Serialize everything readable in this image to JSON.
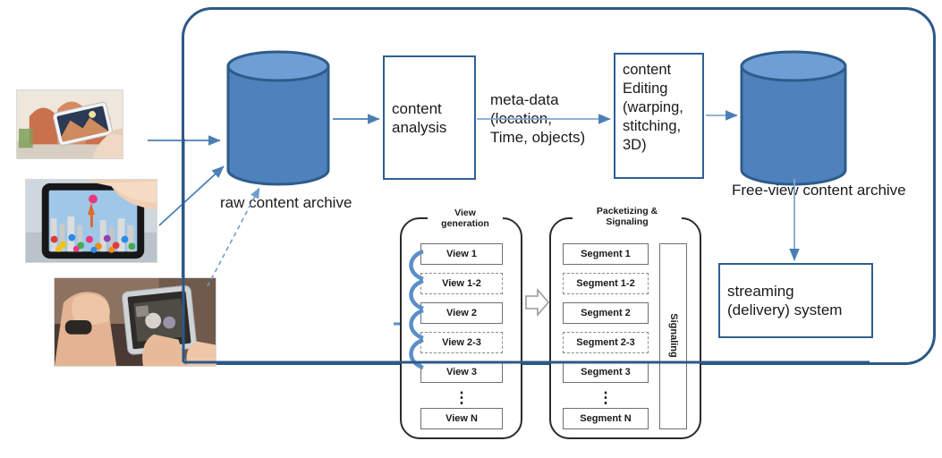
{
  "diagram": {
    "title": "Free-view content production and delivery pipeline",
    "colors": {
      "boundary": "#2d5887",
      "cylinder_body": "#4f81bd",
      "cylinder_top": "#6e9ed4",
      "cylinder_stroke": "#2e5c8a",
      "box_border": "#2f5f93",
      "arrow": "#4a7fb5",
      "panel_border": "#2b2b2b",
      "item_border": "#6f6f6f",
      "text": "#1a1a1a"
    }
  },
  "sources": {
    "photo1_alt": "person holding smartphone photographing a red sandstone palace",
    "photo2_alt": "hands holding smartphone showing a colorful city skyline",
    "photo3_alt": "person holding smartphone photographing an indoor scene"
  },
  "nodes": {
    "raw_archive_label": "raw content archive",
    "content_analysis": "content\nanalysis",
    "metadata_label": "meta-data\n(location,\nTime, objects)",
    "content_editing": "content\nEditing\n(warping,\nstitching,\n3D)",
    "freeview_archive_label": "Free-view content archive",
    "streaming_system": "streaming\n(delivery) system"
  },
  "view_generation": {
    "title": "View\ngeneration",
    "items": [
      {
        "label": "View 1",
        "style": "solid"
      },
      {
        "label": "View 1-2",
        "style": "dashed"
      },
      {
        "label": "View 2",
        "style": "solid"
      },
      {
        "label": "View 2-3",
        "style": "dashed"
      },
      {
        "label": "View 3",
        "style": "solid"
      },
      {
        "label": "View N",
        "style": "solid"
      }
    ],
    "ellipsis": "⋮"
  },
  "packetizing": {
    "title": "Packetizing &\nSignaling",
    "items": [
      {
        "label": "Segment 1",
        "style": "solid"
      },
      {
        "label": "Segment 1-2",
        "style": "dashed"
      },
      {
        "label": "Segment 2",
        "style": "solid"
      },
      {
        "label": "Segment 2-3",
        "style": "dashed"
      },
      {
        "label": "Segment 3",
        "style": "solid"
      },
      {
        "label": "Segment N",
        "style": "solid"
      }
    ],
    "ellipsis": "⋮",
    "signaling_label": "Signaling"
  }
}
